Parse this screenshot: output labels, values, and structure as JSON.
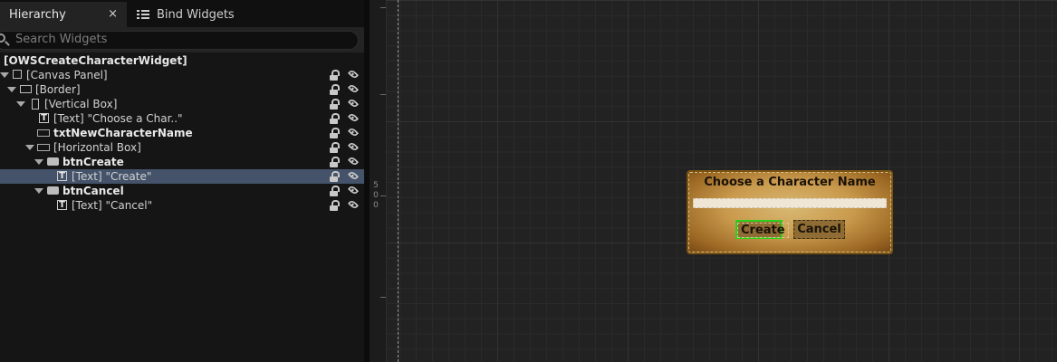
{
  "tabs": {
    "hierarchy": {
      "label": "Hierarchy",
      "close": "×",
      "icon": "hierarchy-tab"
    },
    "bind_widgets": {
      "label": "Bind Widgets",
      "icon": "list-icon"
    }
  },
  "search": {
    "placeholder": "Search Widgets",
    "value": ""
  },
  "hierarchy": {
    "root": "[OWSCreateCharacterWidget]",
    "items": [
      {
        "label": "[Canvas Panel]",
        "type": "canvas-panel",
        "bold": false
      },
      {
        "label": "[Border]",
        "type": "border",
        "bold": false
      },
      {
        "label": "[Vertical Box]",
        "type": "vertical-box",
        "bold": false
      },
      {
        "label": "[Text] \"Choose a Char..\"",
        "type": "text",
        "bold": false
      },
      {
        "label": "txtNewCharacterName",
        "type": "editable-text",
        "bold": true
      },
      {
        "label": "[Horizontal Box]",
        "type": "horizontal-box",
        "bold": false
      },
      {
        "label": "btnCreate",
        "type": "button",
        "bold": true
      },
      {
        "label": "[Text] \"Create\"",
        "type": "text",
        "bold": false,
        "selected": true
      },
      {
        "label": "btnCancel",
        "type": "button",
        "bold": true
      },
      {
        "label": "[Text] \"Cancel\"",
        "type": "text",
        "bold": false
      }
    ]
  },
  "ruler": {
    "label": "5 0 0"
  },
  "preview": {
    "title": "Choose a Character Name",
    "input_value": "",
    "create_label": "Create",
    "cancel_label": "Cancel"
  },
  "colors": {
    "selected_row": "#44536a",
    "selection_outline": "#2bd21a",
    "parchment": "#c99a4d"
  }
}
